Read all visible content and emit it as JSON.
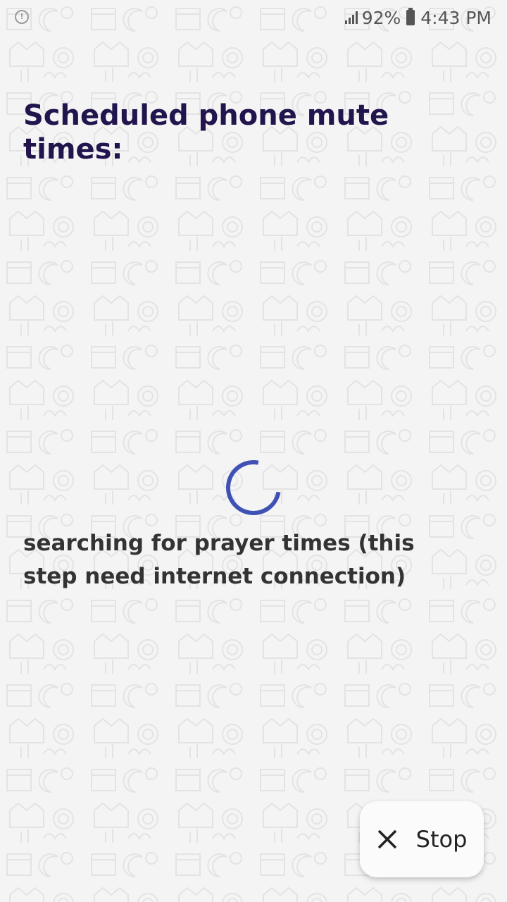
{
  "status_bar": {
    "battery_percent": "92%",
    "time": "4:43 PM",
    "left_icon": "alert-circle-icon",
    "signal_icon": "signal-bars-icon",
    "battery_icon": "battery-icon"
  },
  "main": {
    "title": "Scheduled phone mute times:",
    "spinner_icon": "loading-spinner-icon",
    "message": "searching for prayer times (this step need internet connection)"
  },
  "stop_button": {
    "label": "Stop",
    "icon": "close-icon"
  },
  "colors": {
    "title": "#22144d",
    "spinner": "#3f51b5",
    "background": "#f4f4f4"
  }
}
